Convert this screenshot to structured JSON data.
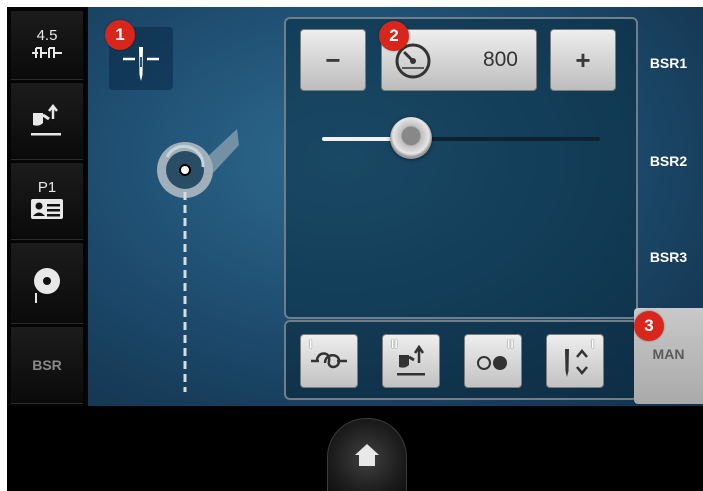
{
  "left_strip": {
    "stitch_length": "4.5",
    "program": "P1",
    "bsr": "BSR"
  },
  "callouts": [
    "1",
    "2",
    "3"
  ],
  "speed": {
    "minus_label": "−",
    "plus_label": "+",
    "value": "800",
    "slider_level_percent": 32
  },
  "right_menu": {
    "items": [
      "BSR1",
      "BSR2",
      "BSR3"
    ],
    "active": "MAN"
  },
  "bottom_buttons": {
    "b1_mark": "I",
    "b2_mark": "II",
    "b3_mark": "II",
    "b4_mark": "I"
  },
  "icons": [
    "needle-position-icon",
    "presser-foot-icon",
    "program-card-icon",
    "bobbin-icon",
    "speedometer-icon",
    "securing-stitch-icon",
    "foot-lift-icon",
    "single-stitch-icon",
    "needle-stop-icon",
    "home-icon"
  ]
}
